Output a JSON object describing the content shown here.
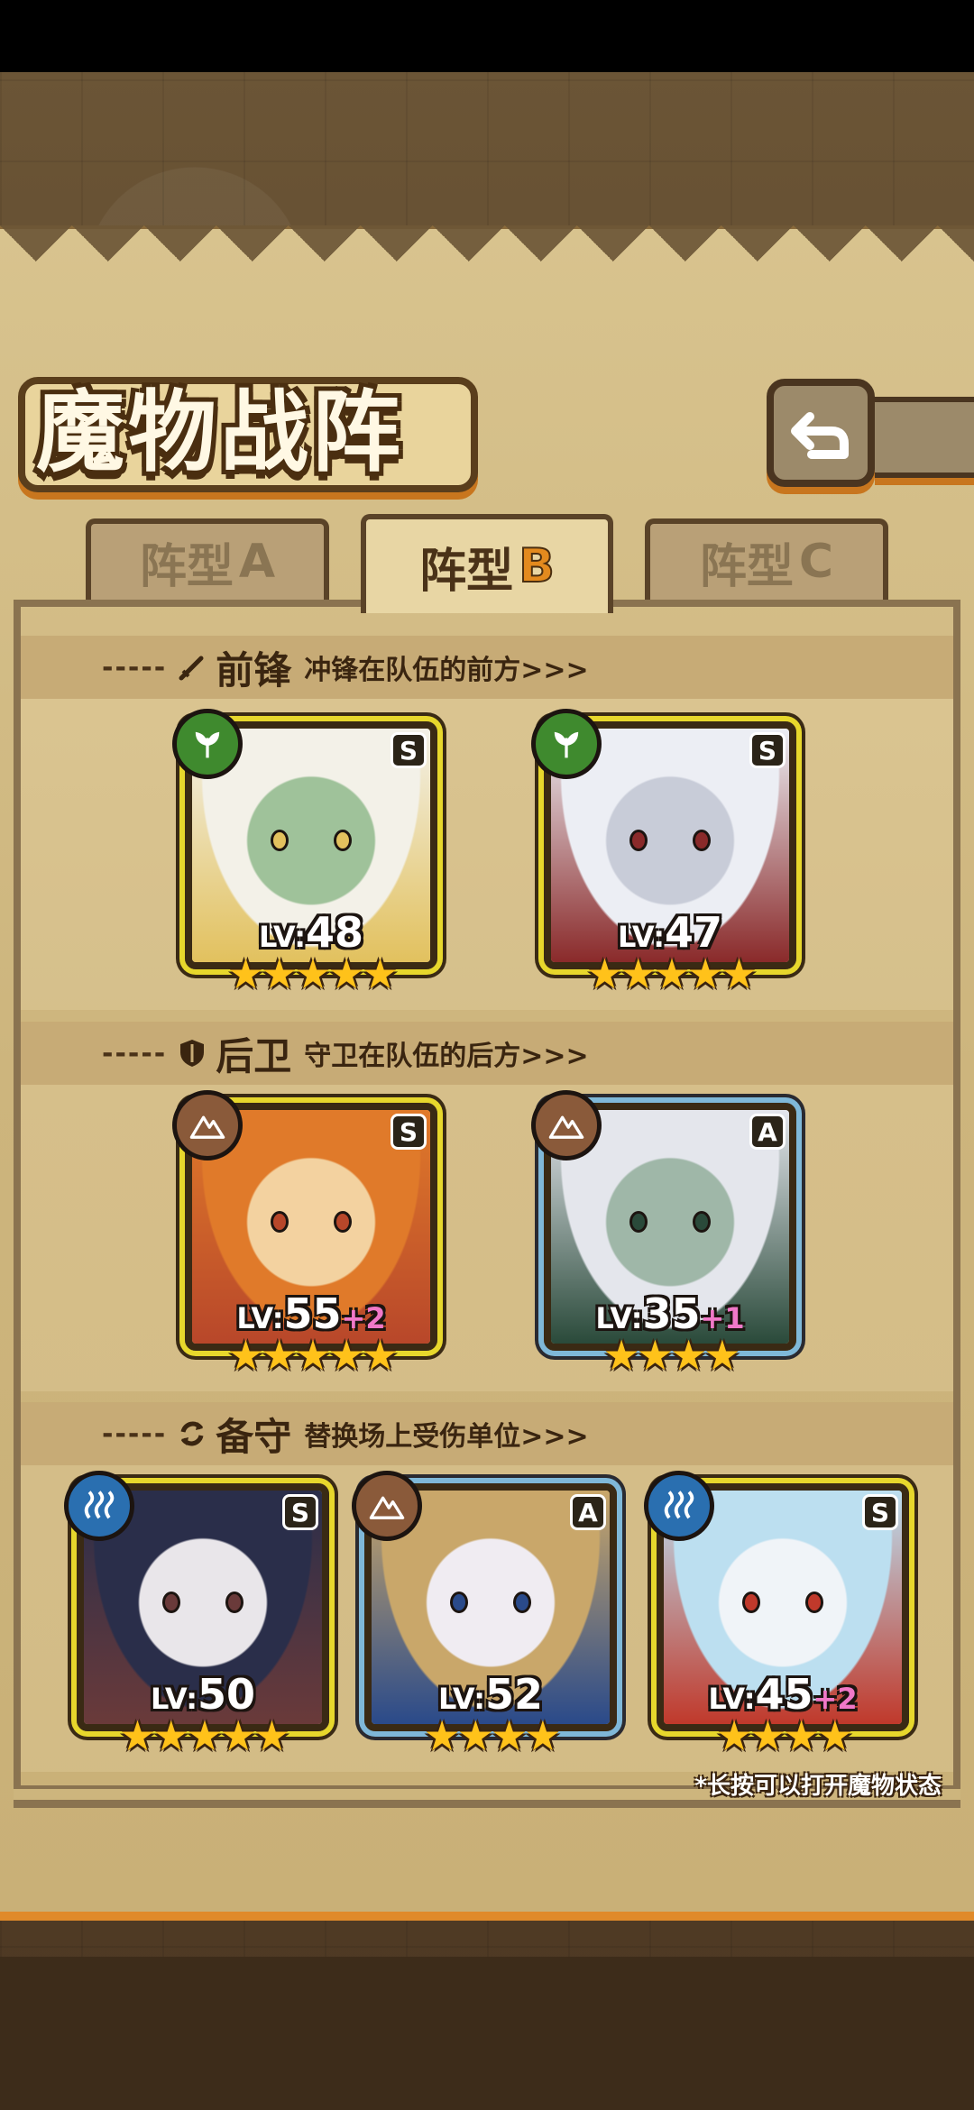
{
  "title": "魔物战阵",
  "tabs": [
    {
      "label": "阵型",
      "letter": "A",
      "active": false
    },
    {
      "label": "阵型",
      "letter": "B",
      "active": true
    },
    {
      "label": "阵型",
      "letter": "C",
      "active": false
    }
  ],
  "sections": {
    "front": {
      "title": "前锋",
      "desc": "冲锋在队伍的前方>>>",
      "icon": "sword-icon"
    },
    "rear": {
      "title": "后卫",
      "desc": "守卫在队伍的后方>>>",
      "icon": "shield-icon"
    },
    "reserve": {
      "title": "备守",
      "desc": "替换场上受伤单位>>>",
      "icon": "swap-arrows-icon"
    }
  },
  "cards": [
    {
      "level": "48",
      "bonus": "",
      "rank": "S",
      "element": "nature",
      "stars": "★★★★★",
      "colors": [
        "#f3f1e8",
        "#9fc29a",
        "#e2c15e"
      ]
    },
    {
      "level": "47",
      "bonus": "",
      "rank": "S",
      "element": "nature",
      "stars": "★★★★★",
      "colors": [
        "#eceef4",
        "#c8ccd8",
        "#8a2a2a"
      ]
    },
    {
      "level": "55",
      "bonus": "+2",
      "rank": "S",
      "element": "earth",
      "stars": "★★★★★",
      "colors": [
        "#e07a2a",
        "#f3d2a0",
        "#b8472a"
      ]
    },
    {
      "level": "35",
      "bonus": "+1",
      "rank": "A",
      "element": "earth",
      "stars": "★★★★",
      "colors": [
        "#e4e6ec",
        "#9fb7a8",
        "#2a4a3a"
      ]
    },
    {
      "level": "50",
      "bonus": "",
      "rank": "S",
      "element": "water",
      "stars": "★★★★★",
      "colors": [
        "#2a2e4a",
        "#e9e6ea",
        "#6a3a3a"
      ]
    },
    {
      "level": "52",
      "bonus": "",
      "rank": "A",
      "element": "earth",
      "stars": "★★★★",
      "colors": [
        "#c9a76a",
        "#f0ecf2",
        "#2a4a8a"
      ]
    },
    {
      "level": "45",
      "bonus": "+2",
      "rank": "S",
      "element": "water",
      "stars": "★★★★",
      "colors": [
        "#bcdff0",
        "#f0f4f8",
        "#c0392b"
      ]
    }
  ],
  "lv_prefix": "LV:",
  "hint": "*长按可以打开魔物状态"
}
